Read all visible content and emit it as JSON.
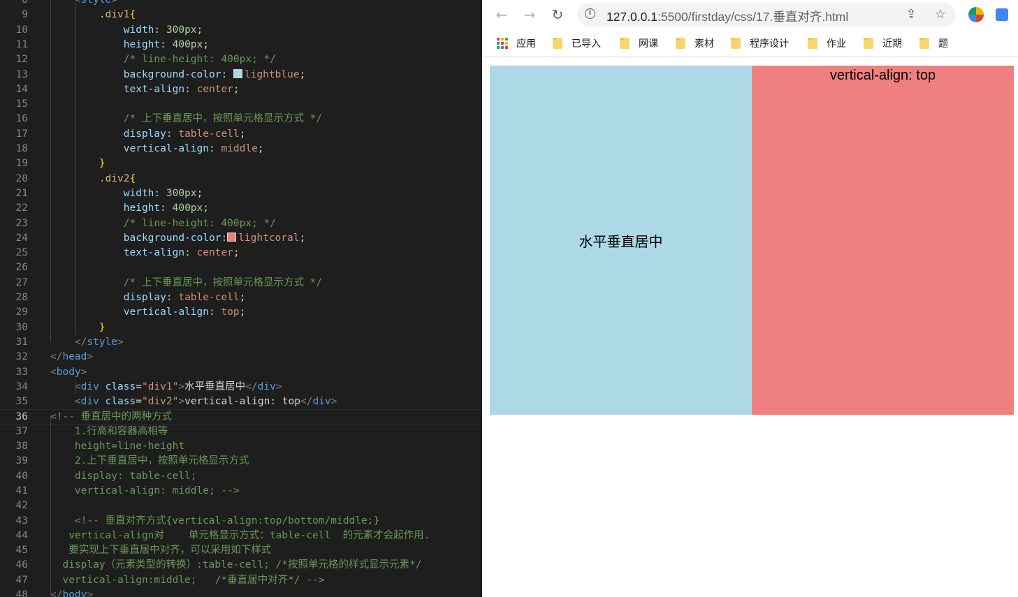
{
  "editor": {
    "current_line": "36",
    "lines": [
      {
        "n": "8",
        "tokens": [
          [
            "t-tag",
            "    <"
          ],
          [
            "t-tagname",
            "style"
          ],
          [
            "t-tag",
            ">"
          ]
        ]
      },
      {
        "n": "9",
        "tokens": [
          [
            "t-sel",
            "        .div1"
          ],
          [
            "t-brace",
            "{"
          ]
        ]
      },
      {
        "n": "10",
        "tokens": [
          [
            "t-prop",
            "            width"
          ],
          [
            "t-txt",
            ": "
          ],
          [
            "t-num",
            "300px"
          ],
          [
            "t-txt",
            ";"
          ]
        ]
      },
      {
        "n": "11",
        "tokens": [
          [
            "t-prop",
            "            height"
          ],
          [
            "t-txt",
            ": "
          ],
          [
            "t-num",
            "400px"
          ],
          [
            "t-txt",
            ";"
          ]
        ]
      },
      {
        "n": "12",
        "tokens": [
          [
            "t-cmt",
            "            /* line-height: 400px; */"
          ]
        ]
      },
      {
        "n": "13",
        "tokens": [
          [
            "t-prop",
            "            background-color"
          ],
          [
            "t-txt",
            ": "
          ],
          [
            "swatch",
            "#add8e6"
          ],
          [
            "t-val",
            "lightblue"
          ],
          [
            "t-txt",
            ";"
          ]
        ]
      },
      {
        "n": "14",
        "tokens": [
          [
            "t-prop",
            "            text-align"
          ],
          [
            "t-txt",
            ": "
          ],
          [
            "t-val",
            "center"
          ],
          [
            "t-txt",
            ";"
          ]
        ]
      },
      {
        "n": "15",
        "tokens": []
      },
      {
        "n": "16",
        "tokens": [
          [
            "t-cmt",
            "            /* 上下垂直居中，按照单元格显示方式 */"
          ]
        ]
      },
      {
        "n": "17",
        "tokens": [
          [
            "t-prop",
            "            display"
          ],
          [
            "t-txt",
            ": "
          ],
          [
            "t-val",
            "table-cell"
          ],
          [
            "t-txt",
            ";"
          ]
        ]
      },
      {
        "n": "18",
        "tokens": [
          [
            "t-prop",
            "            vertical-align"
          ],
          [
            "t-txt",
            ": "
          ],
          [
            "t-val",
            "middle"
          ],
          [
            "t-txt",
            ";"
          ]
        ]
      },
      {
        "n": "19",
        "tokens": [
          [
            "t-brace",
            "        }"
          ]
        ]
      },
      {
        "n": "20",
        "tokens": [
          [
            "t-sel",
            "        .div2"
          ],
          [
            "t-brace",
            "{"
          ]
        ]
      },
      {
        "n": "21",
        "tokens": [
          [
            "t-prop",
            "            width"
          ],
          [
            "t-txt",
            ": "
          ],
          [
            "t-num",
            "300px"
          ],
          [
            "t-txt",
            ";"
          ]
        ]
      },
      {
        "n": "22",
        "tokens": [
          [
            "t-prop",
            "            height"
          ],
          [
            "t-txt",
            ": "
          ],
          [
            "t-num",
            "400px"
          ],
          [
            "t-txt",
            ";"
          ]
        ]
      },
      {
        "n": "23",
        "tokens": [
          [
            "t-cmt",
            "            /* line-height: 400px; */"
          ]
        ]
      },
      {
        "n": "24",
        "tokens": [
          [
            "t-prop",
            "            background-color"
          ],
          [
            "t-txt",
            ":"
          ],
          [
            "swatch",
            "#f08080"
          ],
          [
            "t-val",
            "lightcoral"
          ],
          [
            "t-txt",
            ";"
          ]
        ]
      },
      {
        "n": "25",
        "tokens": [
          [
            "t-prop",
            "            text-align"
          ],
          [
            "t-txt",
            ": "
          ],
          [
            "t-val",
            "center"
          ],
          [
            "t-txt",
            ";"
          ]
        ]
      },
      {
        "n": "26",
        "tokens": []
      },
      {
        "n": "27",
        "tokens": [
          [
            "t-cmt",
            "            /* 上下垂直居中，按照单元格显示方式 */"
          ]
        ]
      },
      {
        "n": "28",
        "tokens": [
          [
            "t-prop",
            "            display"
          ],
          [
            "t-txt",
            ": "
          ],
          [
            "t-val",
            "table-cell"
          ],
          [
            "t-txt",
            ";"
          ]
        ]
      },
      {
        "n": "29",
        "tokens": [
          [
            "t-prop",
            "            vertical-align"
          ],
          [
            "t-txt",
            ": "
          ],
          [
            "t-val",
            "top"
          ],
          [
            "t-txt",
            ";"
          ]
        ]
      },
      {
        "n": "30",
        "tokens": [
          [
            "t-brace",
            "        }"
          ]
        ]
      },
      {
        "n": "31",
        "tokens": [
          [
            "t-tag",
            "    </"
          ],
          [
            "t-tagname",
            "style"
          ],
          [
            "t-tag",
            ">"
          ]
        ]
      },
      {
        "n": "32",
        "tokens": [
          [
            "t-tag",
            "</"
          ],
          [
            "t-tagname",
            "head"
          ],
          [
            "t-tag",
            ">"
          ]
        ]
      },
      {
        "n": "33",
        "tokens": [
          [
            "t-tag",
            "<"
          ],
          [
            "t-tagname",
            "body"
          ],
          [
            "t-tag",
            ">"
          ]
        ]
      },
      {
        "n": "34",
        "tokens": [
          [
            "t-tag",
            "    <"
          ],
          [
            "t-tagname",
            "div"
          ],
          [
            "t-txt",
            " "
          ],
          [
            "t-attr",
            "class"
          ],
          [
            "t-txt",
            "="
          ],
          [
            "t-str",
            "\"div1\""
          ],
          [
            "t-tag",
            ">"
          ],
          [
            "t-txt",
            "水平垂直居中"
          ],
          [
            "t-tag",
            "</"
          ],
          [
            "t-tagname",
            "div"
          ],
          [
            "t-tag",
            ">"
          ]
        ]
      },
      {
        "n": "35",
        "tokens": [
          [
            "t-tag",
            "    <"
          ],
          [
            "t-tagname",
            "div"
          ],
          [
            "t-txt",
            " "
          ],
          [
            "t-attr",
            "class"
          ],
          [
            "t-txt",
            "="
          ],
          [
            "t-str",
            "\"div2\""
          ],
          [
            "t-tag",
            ">"
          ],
          [
            "t-txt",
            "vertical-align: top"
          ],
          [
            "t-tag",
            "</"
          ],
          [
            "t-tagname",
            "div"
          ],
          [
            "t-tag",
            ">"
          ]
        ]
      },
      {
        "n": "36",
        "tokens": [
          [
            "t-cmt",
            "<!-- 垂直居中的两种方式"
          ]
        ]
      },
      {
        "n": "37",
        "tokens": [
          [
            "t-cmt",
            "    1.行高和容器高相等"
          ]
        ]
      },
      {
        "n": "38",
        "tokens": [
          [
            "t-cmt",
            "    height=line-height"
          ]
        ]
      },
      {
        "n": "39",
        "tokens": [
          [
            "t-cmt",
            "    2.上下垂直居中，按照单元格显示方式"
          ]
        ]
      },
      {
        "n": "40",
        "tokens": [
          [
            "t-cmt",
            "    display: table-cell;"
          ]
        ]
      },
      {
        "n": "41",
        "tokens": [
          [
            "t-cmt",
            "    vertical-align: middle; -->"
          ]
        ]
      },
      {
        "n": "42",
        "tokens": []
      },
      {
        "n": "43",
        "tokens": [
          [
            "t-cmt",
            "    <!-- 垂直对齐方式{vertical-align:top/bottom/middle;}"
          ]
        ]
      },
      {
        "n": "44",
        "tokens": [
          [
            "t-cmt",
            "   vertical-align对    单元格显示方式：table-cell  的元素才会起作用."
          ]
        ]
      },
      {
        "n": "45",
        "tokens": [
          [
            "t-cmt",
            "   要实现上下垂直居中对齐，可以采用如下样式"
          ]
        ]
      },
      {
        "n": "46",
        "tokens": [
          [
            "t-cmt",
            "  display（元素类型的转换）:table-cell; /*按照单元格的样式显示元素*/"
          ]
        ]
      },
      {
        "n": "47",
        "tokens": [
          [
            "t-cmt",
            "  vertical-align:middle;   /*垂直居中对齐*/ -->"
          ]
        ]
      },
      {
        "n": "48",
        "tokens": [
          [
            "t-tag",
            "</"
          ],
          [
            "t-tagname",
            "body"
          ],
          [
            "t-tag",
            ">"
          ]
        ]
      }
    ]
  },
  "browser": {
    "url_host": "127.0.0.1",
    "url_rest": ":5500/firstday/css/17.垂直对齐.html",
    "nav": {
      "back": "←",
      "forward": "→",
      "reload": "↻"
    },
    "omni_icons": {
      "share": "⇪",
      "star": "☆"
    },
    "bookmarks": [
      {
        "label": "应用",
        "icon": "apps-grid-icon"
      },
      {
        "label": "已导入",
        "icon": "folder-icon"
      },
      {
        "label": "网课",
        "icon": "folder-icon"
      },
      {
        "label": "素材",
        "icon": "folder-icon"
      },
      {
        "label": "程序设计",
        "icon": "folder-icon"
      },
      {
        "label": "作业",
        "icon": "folder-icon"
      },
      {
        "label": "近期",
        "icon": "folder-icon"
      },
      {
        "label": "题",
        "icon": "folder-icon"
      }
    ],
    "page": {
      "div1_text": "水平垂直居中",
      "div2_text": "vertical-align: top",
      "div1_color": "#add8e6",
      "div2_color": "#f08080"
    }
  }
}
